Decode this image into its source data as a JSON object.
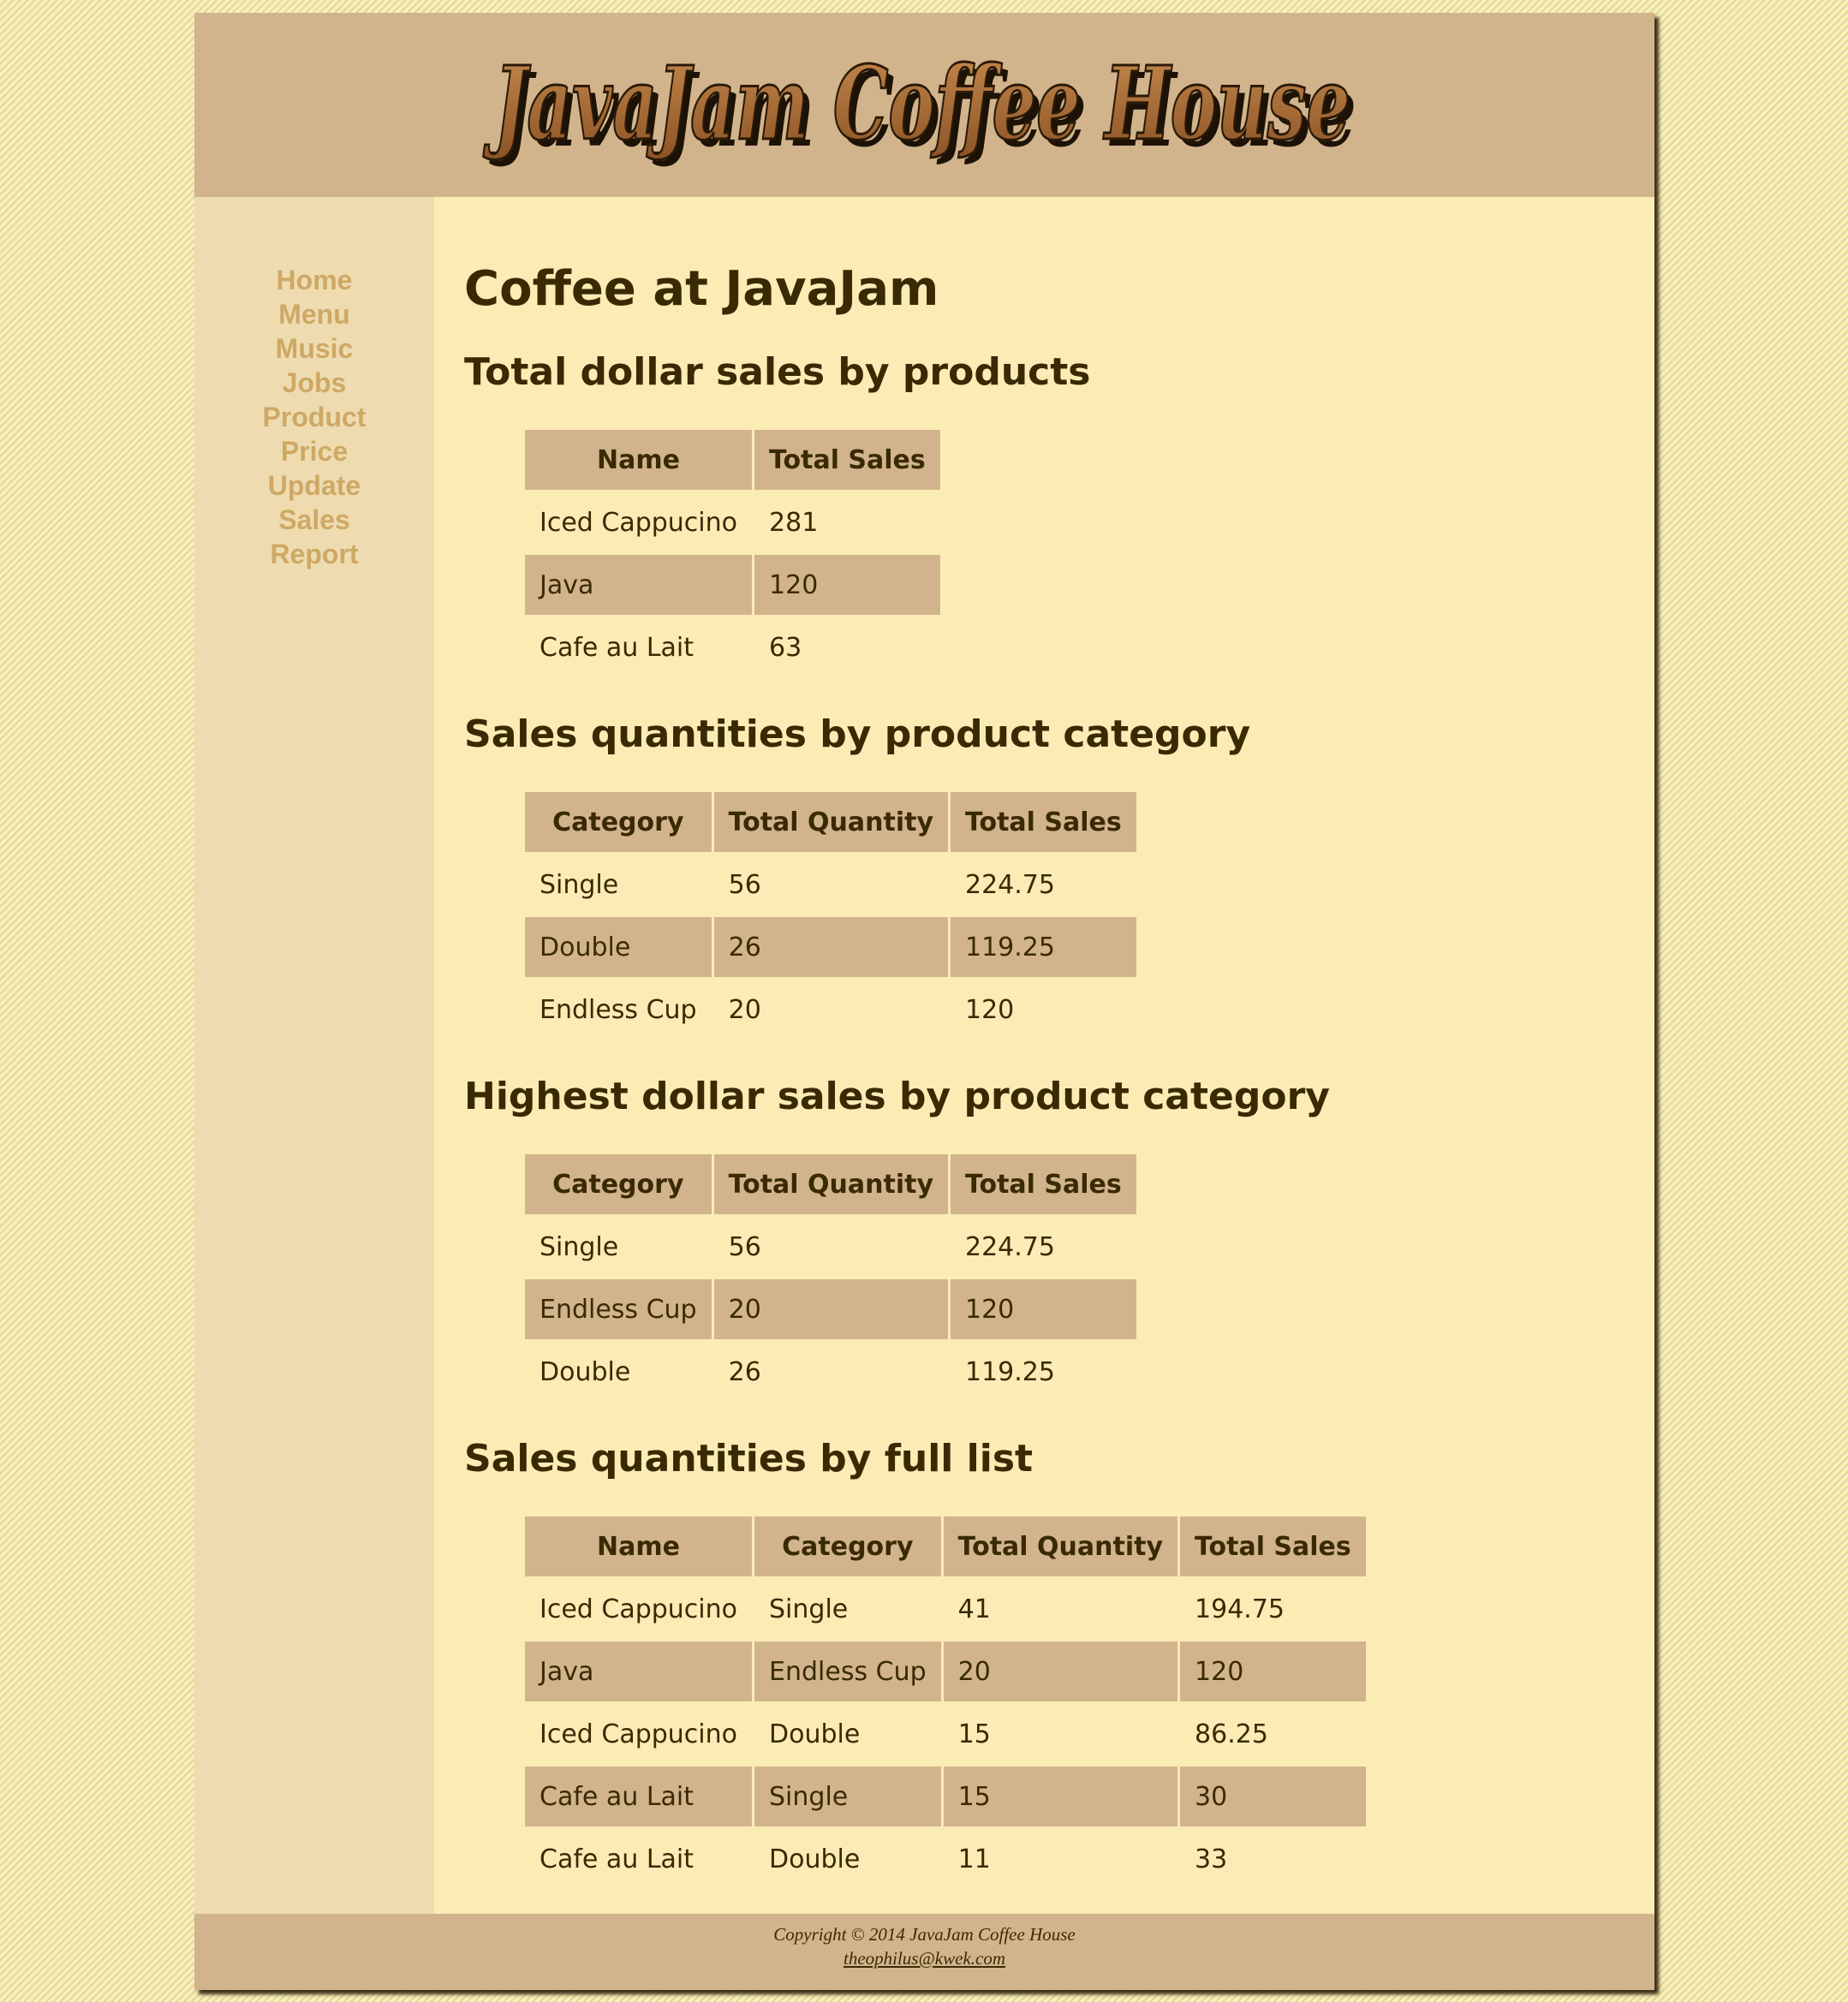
{
  "header": {
    "logo_text": "JavaJam Coffee House"
  },
  "nav": {
    "items": [
      "Home",
      "Menu",
      "Music",
      "Jobs",
      "Product",
      "Price",
      "Update",
      "Sales",
      "Report"
    ]
  },
  "main": {
    "title": "Coffee at JavaJam",
    "sections": [
      {
        "heading": "Total dollar sales by products",
        "columns": [
          "Name",
          "Total Sales"
        ],
        "rows": [
          [
            "Iced Cappucino",
            "281"
          ],
          [
            "Java",
            "120"
          ],
          [
            "Cafe au Lait",
            "63"
          ]
        ]
      },
      {
        "heading": "Sales quantities by product category",
        "columns": [
          "Category",
          "Total Quantity",
          "Total Sales"
        ],
        "rows": [
          [
            "Single",
            "56",
            "224.75"
          ],
          [
            "Double",
            "26",
            "119.25"
          ],
          [
            "Endless Cup",
            "20",
            "120"
          ]
        ]
      },
      {
        "heading": "Highest dollar sales by product category",
        "columns": [
          "Category",
          "Total Quantity",
          "Total Sales"
        ],
        "rows": [
          [
            "Single",
            "56",
            "224.75"
          ],
          [
            "Endless Cup",
            "20",
            "120"
          ],
          [
            "Double",
            "26",
            "119.25"
          ]
        ]
      },
      {
        "heading": "Sales quantities by full list",
        "columns": [
          "Name",
          "Category",
          "Total Quantity",
          "Total Sales"
        ],
        "rows": [
          [
            "Iced Cappucino",
            "Single",
            "41",
            "194.75"
          ],
          [
            "Java",
            "Endless Cup",
            "20",
            "120"
          ],
          [
            "Iced Cappucino",
            "Double",
            "15",
            "86.25"
          ],
          [
            "Cafe au Lait",
            "Single",
            "15",
            "30"
          ],
          [
            "Cafe au Lait",
            "Double",
            "11",
            "33"
          ]
        ]
      }
    ]
  },
  "footer": {
    "copyright": "Copyright © 2014 JavaJam Coffee House",
    "email": "theophilus@kwek.com"
  },
  "colors": {
    "page_background": "#f3eaa8",
    "content_background": "#fbecb5",
    "header_background": "#d2b48c",
    "nav_background": "#eedcb0",
    "nav_link": "#cea865",
    "text": "#3a2a04",
    "logo_fill": "#a0652d"
  }
}
